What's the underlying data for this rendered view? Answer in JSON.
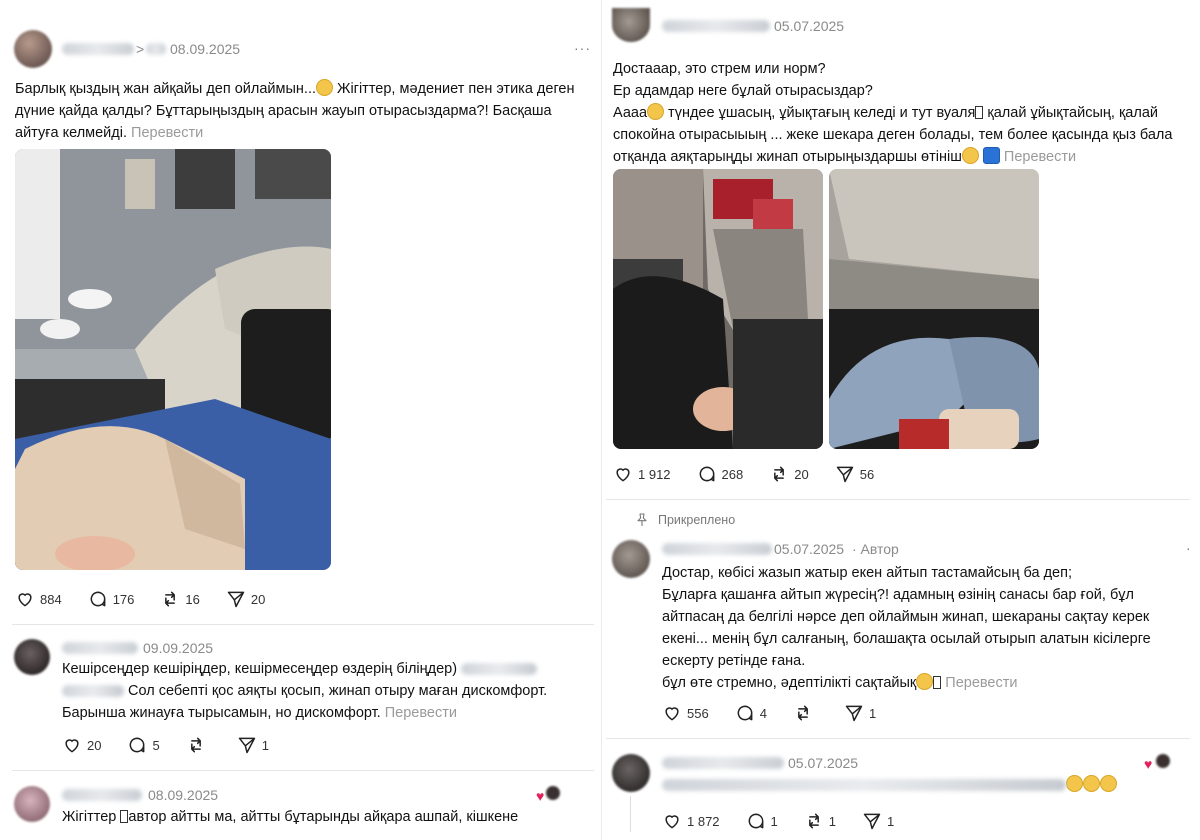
{
  "left": {
    "post1": {
      "date": "08.09.2025",
      "separator": ">",
      "more": "···",
      "text1": "Барлық қыздың жан айқайы деп ойлаймын...",
      "text2": " Жігіттер, мәдениет пен этика деген дүние қайда қалды? Бұттарыңыздың арасын жауып отырасыздарма?! Басқаша айтуға келмейді.",
      "translate": "Перевести",
      "likes": "884",
      "replies": "176",
      "reposts": "16",
      "shares": "20"
    },
    "reply1": {
      "date": "09.09.2025",
      "line1": "Кешірсеңдер кешіріңдер, кешірмесеңдер өздерің біліңдер)",
      "line2": "Сол себепті қос аяқты қосып, жинап отыру маған дискомфорт.",
      "line3": "Барынша жинауға тырысамын, но дискомфорт.",
      "translate": "Перевести",
      "likes": "20",
      "replies": "5",
      "reposts": "",
      "shares": "1"
    },
    "reply2": {
      "date": "08.09.2025",
      "line1": "Жігіттер",
      "line1b": "автор айтты ма, айтты бұтарынды айқара ашпай, кішкене"
    }
  },
  "right": {
    "post1": {
      "date": "05.07.2025",
      "line1": "Достааар, это стрем или норм?",
      "line2": "Ер адамдар неге бұлай отырасыздар?",
      "line3a": "Аааа",
      "line3b": " түндее ұшасың, ұйықтағың келеді и тут вуаля",
      "line3c": " қалай ұйықтайсың, қалай",
      "line4": "спокойна отырасыыың ... жеке шекара деген болады, тем более қасында қыз бала",
      "line5": "отқанда аяқтарыңды жинап отырыңыздаршы өтініш",
      "translate": "Перевести",
      "likes": "1 912",
      "replies": "268",
      "reposts": "20",
      "shares": "56"
    },
    "pinned": {
      "label": "Прикреплено",
      "date": "05.07.2025",
      "author": "· Автор",
      "line1": "Достар, көбісі жазып жатыр екен айтып тастамайсың ба деп;",
      "line2": "Бұларға қашанға айтып жүресің?! адамның өзінің санасы бар ғой, бұл",
      "line3": "айтпасаң да белгілі нәрсе деп ойлаймын жинап, шекараны сақтау керек",
      "line4": "екені... менің бұл салғаның, болашақта осылай отырып алатын кісілерге",
      "line5": "ескерту ретінде ғана.",
      "line6": "бұл өте стремно, әдептілікті сақтайық",
      "translate": "Перевести",
      "likes": "556",
      "replies": "4",
      "reposts": "",
      "shares": "1"
    },
    "reply": {
      "date": "05.07.2025",
      "likes": "1 872",
      "replies": "1",
      "reposts": "1",
      "shares": "1"
    }
  },
  "colors": {
    "meta_gray": "#8a8a8a",
    "translate_gray": "#9a9a9a",
    "divider": "#e6e6e6",
    "heart": "#e0245e"
  }
}
